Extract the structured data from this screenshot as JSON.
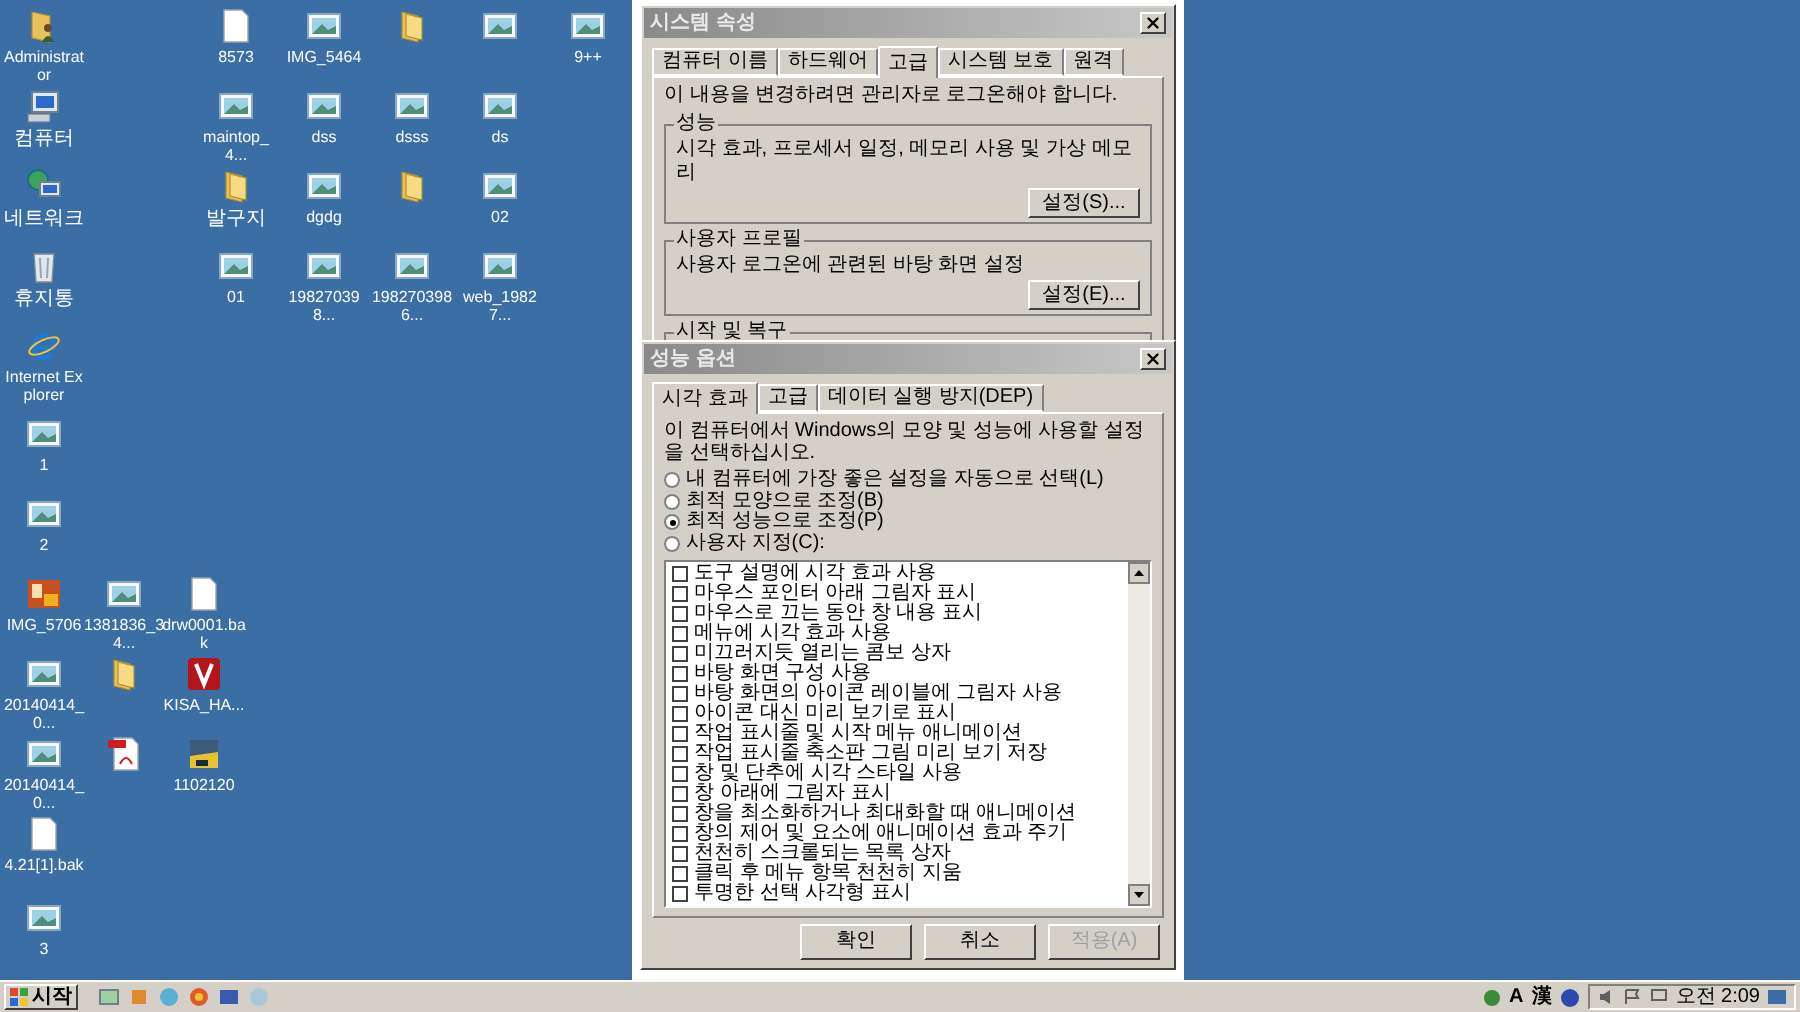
{
  "desktop": {
    "icons": [
      {
        "kind": "user-folder",
        "label": "Administrator"
      },
      {
        "kind": "computer",
        "label": "컴퓨터"
      },
      {
        "kind": "network",
        "label": "네트워크"
      },
      {
        "kind": "trash",
        "label": "휴지통"
      },
      {
        "kind": "browser",
        "label": "Internet Explorer"
      },
      {
        "kind": "image",
        "label": "1"
      },
      {
        "kind": "image",
        "label": "2"
      },
      {
        "kind": "photo-app",
        "label": "IMG_5706"
      },
      {
        "kind": "image",
        "label": "1381836_34..."
      },
      {
        "kind": "file",
        "label": "drw0001.bak"
      },
      {
        "kind": "image",
        "label": "20140414_0..."
      },
      {
        "kind": "folder"
      },
      {
        "kind": "v-app",
        "label": "KISA_HA..."
      },
      {
        "kind": "image",
        "label": "20140414_0..."
      },
      {
        "kind": "pdf"
      },
      {
        "kind": "archive",
        "label": "1102120"
      },
      {
        "kind": "file",
        "label": "4.21[1].bak"
      },
      {
        "kind": "image",
        "label": "3"
      },
      {
        "kind": "file",
        "label": "8573"
      },
      {
        "kind": "image",
        "label": "IMG_5464"
      },
      {
        "kind": "folder"
      },
      {
        "kind": "image"
      },
      {
        "kind": "image",
        "label": "9++"
      },
      {
        "kind": "image",
        "label": "maintop_4..."
      },
      {
        "kind": "image",
        "label": "dss"
      },
      {
        "kind": "image",
        "label": "dsss"
      },
      {
        "kind": "image",
        "label": "ds"
      },
      {
        "kind": "folder",
        "label": "발구지"
      },
      {
        "kind": "image",
        "label": "dgdg"
      },
      {
        "kind": "folder"
      },
      {
        "kind": "image",
        "label": "02"
      },
      {
        "kind": "image",
        "label": "01"
      },
      {
        "kind": "image",
        "label": "198270398..."
      },
      {
        "kind": "image",
        "label": "1982703986..."
      },
      {
        "kind": "image",
        "label": "web_19827..."
      }
    ]
  },
  "system_properties": {
    "title": "시스템 속성",
    "tabs": [
      {
        "label": "컴퓨터 이름",
        "selected": false
      },
      {
        "label": "하드웨어",
        "selected": false
      },
      {
        "label": "고급",
        "selected": true
      },
      {
        "label": "시스템 보호",
        "selected": false
      },
      {
        "label": "원격",
        "selected": false
      }
    ],
    "notice": "이 내용을 변경하려면 관리자로 로그온해야 합니다.",
    "groups": [
      {
        "title": "성능",
        "text": "시각 효과, 프로세서 일정, 메모리 사용 및 가상 메모리",
        "button": "설정(S)..."
      },
      {
        "title": "사용자 프로필",
        "text": "사용자 로그온에 관련된 바탕 화면 설정",
        "button": "설정(E)..."
      },
      {
        "title": "시작 및 복구"
      }
    ]
  },
  "performance_options": {
    "title": "성능 옵션",
    "tabs": [
      {
        "label": "시각 효과",
        "selected": true
      },
      {
        "label": "고급",
        "selected": false
      },
      {
        "label": "데이터 실행 방지(DEP)",
        "selected": false
      }
    ],
    "description": "이 컴퓨터에서 Windows의 모양 및 성능에 사용할 설정을 선택하십시오.",
    "options": [
      {
        "label": "내 컴퓨터에 가장 좋은 설정을 자동으로 선택(L)",
        "selected": false
      },
      {
        "label": "최적 모양으로 조정(B)",
        "selected": false
      },
      {
        "label": "최적 성능으로 조정(P)",
        "selected": true
      },
      {
        "label": "사용자 지정(C):",
        "selected": false
      }
    ],
    "effects": [
      {
        "label": "도구 설명에 시각 효과 사용",
        "checked": false
      },
      {
        "label": "마우스 포인터 아래 그림자 표시",
        "checked": false
      },
      {
        "label": "마우스로 끄는 동안 창 내용 표시",
        "checked": false
      },
      {
        "label": "메뉴에 시각 효과 사용",
        "checked": false
      },
      {
        "label": "미끄러지듯 열리는 콤보 상자",
        "checked": false
      },
      {
        "label": "바탕 화면 구성 사용",
        "checked": false
      },
      {
        "label": "바탕 화면의 아이콘 레이블에 그림자 사용",
        "checked": false
      },
      {
        "label": "아이콘 대신 미리 보기로 표시",
        "checked": false
      },
      {
        "label": "작업 표시줄 및 시작 메뉴 애니메이션",
        "checked": false
      },
      {
        "label": "작업 표시줄 축소판 그림 미리 보기 저장",
        "checked": false
      },
      {
        "label": "창 및 단추에 시각 스타일 사용",
        "checked": false
      },
      {
        "label": "창 아래에 그림자 표시",
        "checked": false
      },
      {
        "label": "창을 최소화하거나 최대화할 때 애니메이션",
        "checked": false
      },
      {
        "label": "창의 제어 및 요소에 애니메이션 효과 주기",
        "checked": false
      },
      {
        "label": "천천히 스크롤되는 목록 상자",
        "checked": false
      },
      {
        "label": "클릭 후 메뉴 항목 천천히 지움",
        "checked": false
      },
      {
        "label": "투명한 선택 사각형 표시",
        "checked": false
      }
    ],
    "buttons": [
      {
        "label": "확인",
        "disabled": false
      },
      {
        "label": "취소",
        "disabled": false
      },
      {
        "label": "적용(A)",
        "disabled": true
      }
    ]
  },
  "taskbar": {
    "start": "시작",
    "tray": {
      "ime_mode": "A",
      "hanja": "漢",
      "clock": "오전 2:09"
    }
  }
}
